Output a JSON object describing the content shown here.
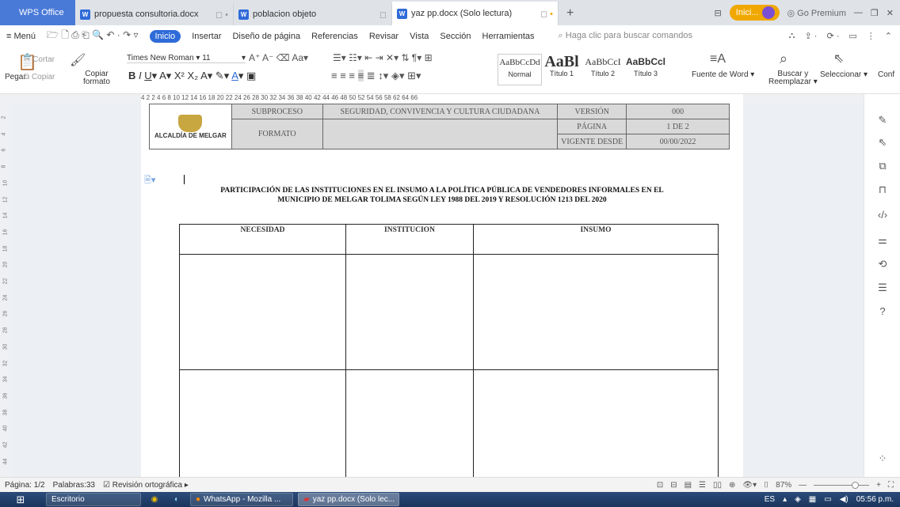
{
  "titlebar": {
    "app_name": "WPS Office",
    "tabs": [
      {
        "label": "propuesta consultoria.docx"
      },
      {
        "label": "poblacion objeto"
      },
      {
        "label": "yaz pp.docx (Solo lectura)"
      }
    ],
    "inicio_label": "Inici...",
    "premium_label": "Go Premium"
  },
  "menu": {
    "menu_label": "Menú",
    "items": [
      "Inicio",
      "Insertar",
      "Diseño de página",
      "Referencias",
      "Revisar",
      "Vista",
      "Sección",
      "Herramientas"
    ],
    "search_placeholder": "Haga clic para buscar comandos"
  },
  "ribbon": {
    "cut": "Cortar",
    "copy": "Copiar",
    "paste": "Pegar",
    "format_copy_1": "Copiar",
    "format_copy_2": "formato",
    "font_name": "Times New Roman",
    "font_size": "11",
    "styles": [
      {
        "sample": "AaBbCcDd",
        "label": "Normal"
      },
      {
        "sample": "AaBl",
        "label": "Título 1"
      },
      {
        "sample": "AaBbCcI",
        "label": "Título 2"
      },
      {
        "sample": "AaBbCcl",
        "label": "Título 3"
      }
    ],
    "font_source": "Fuente de Word",
    "find_replace_1": "Buscar y",
    "find_replace_2": "Reemplazar",
    "select": "Seleccionar",
    "conf": "Conf"
  },
  "ruler": {
    "numbers": "4   2        2    4    6    8   10   12   14   16   18   20   22   24   26   28   30   32   34   36   38   40   42   44   46   48   50   52   54   56   58       62   64   66"
  },
  "document": {
    "header": {
      "logo_text": "ALCALDÍA DE MELGAR",
      "row1": {
        "label": "SUBPROCESO",
        "value": "SEGURIDAD, CONVIVENCIA Y CULTURA CIUDADANA",
        "key": "VERSIÓN",
        "val": "000"
      },
      "row2": {
        "label": "FORMATO",
        "key": "PÁGINA",
        "val": "1 DE 2"
      },
      "row3": {
        "key": "VIGENTE DESDE",
        "val": "00/00/2022"
      }
    },
    "title_line1": "PARTICIPACIÓN DE LAS INSTITUCIONES EN EL INSUMO A LA POLÍTICA PÚBLICA DE VENDEDORES INFORMALES EN EL",
    "title_line2": "MUNICIPIO DE MELGAR TOLIMA SEGÚN LEY 1988 DEL 2019 Y RESOLUCIÓN 1213 DEL 2020",
    "table_headers": [
      "NECESIDAD",
      "INSTITUCION",
      "INSUMO"
    ]
  },
  "statusbar": {
    "page": "Página: 1/2",
    "words": "Palabras:33",
    "spell": "Revisión ortográfica",
    "zoom": "87%"
  },
  "taskbar": {
    "items": [
      "Escritorio",
      "WhatsApp - Mozilla ...",
      "yaz pp.docx (Solo lec..."
    ],
    "lang": "ES",
    "time": "05:56 p.m."
  },
  "colors": {
    "accent": "#2f6bd8",
    "inicio": "#f0a800",
    "titlebar": "#dfe3e8"
  }
}
